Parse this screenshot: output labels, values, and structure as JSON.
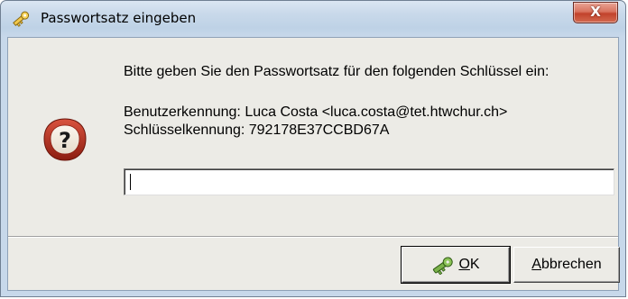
{
  "window": {
    "title": "Passwortsatz eingeben",
    "close_glyph": "X"
  },
  "dialog": {
    "prompt": "Bitte geben Sie den Passwortsatz für den folgenden Schlüssel ein:",
    "user_id": "Benutzerkennung: Luca Costa <luca.costa@tet.htwchur.ch>",
    "key_id": "Schlüsselkennung: 792178E37CCBD67A",
    "passphrase_value": ""
  },
  "buttons": {
    "ok_mnemonic": "O",
    "ok_rest": "K",
    "cancel_mnemonic": "A",
    "cancel_rest": "bbrechen"
  },
  "icons": {
    "title": "key-app-icon",
    "dialog": "question-mark-icon",
    "ok": "key-ok-icon",
    "close": "close-icon"
  },
  "colors": {
    "close_button": "#c2432c",
    "dialog_face": "#ecebe6",
    "icon_ring": "#a1281a"
  }
}
